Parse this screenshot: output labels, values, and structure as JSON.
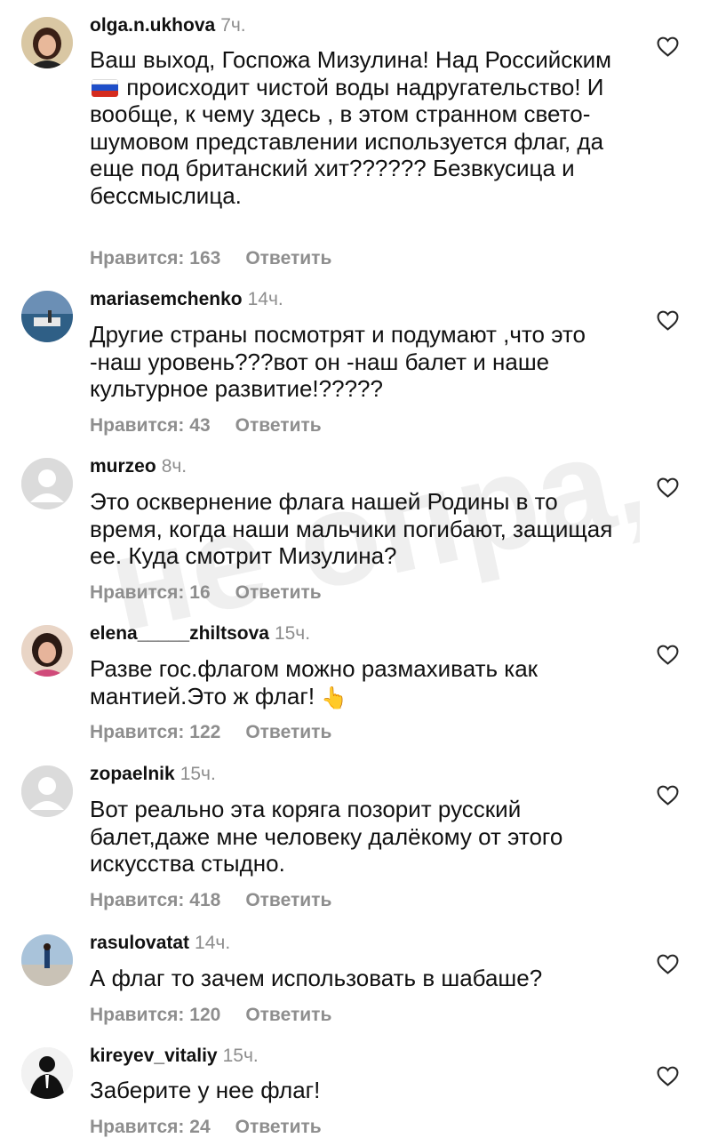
{
  "comments": [
    {
      "username": "olga.n.ukhova",
      "time": "7ч.",
      "text_before_flag": "Ваш выход, Госпожа Мизулина! Над Российским",
      "text_after_flag": " происходит чистой воды надругательство!  И вообще, к чему здесь , в этом странном свето-шумовом представлении используется флаг, да еще под британский хит?????? Безвкусица и бессмыслица.",
      "likes": "Нравится: 163",
      "reply": "Ответить"
    },
    {
      "username": "mariasemchenko",
      "time": "14ч.",
      "text": "Другие страны посмотрят и подумают ,что это -наш уровень???вот он -наш балет и наше культурное развитие!?????",
      "likes": "Нравится: 43",
      "reply": "Ответить"
    },
    {
      "username": "murzeo",
      "time": "8ч.",
      "text": "Это осквернение флага нашей Родины в то время, когда наши мальчики погибают, защищая ее. Куда смотрит Мизулина?",
      "likes": "Нравится: 16",
      "reply": "Ответить"
    },
    {
      "username": "elena_____zhiltsova",
      "time": "15ч.",
      "text": "Разве гос.флагом можно размахивать как мантией.Это ж флаг! ",
      "emoji": "👆",
      "likes": "Нравится: 122",
      "reply": "Ответить"
    },
    {
      "username": "zopaelnik",
      "time": "15ч.",
      "text": "Вот реально эта коряга позорит русский балет,даже мне человеку далёкому от этого искусства стыдно.",
      "likes": "Нравится: 418",
      "reply": "Ответить"
    },
    {
      "username": "rasulovatat",
      "time": "14ч.",
      "text": "А флаг то зачем использовать в шабаше?",
      "likes": "Нравится: 120",
      "reply": "Ответить"
    },
    {
      "username": "kireyev_vitaliy",
      "time": "15ч.",
      "text": "Заберите у нее флаг!",
      "likes": "Нравится: 24",
      "reply": "Ответить"
    }
  ],
  "watermark_text": "не опра,",
  "colors": {
    "text": "#111111",
    "meta": "#8e8e8e",
    "background": "#ffffff"
  },
  "icons": {
    "like": "heart-outline-icon",
    "flag": "russia-flag-emoji"
  }
}
